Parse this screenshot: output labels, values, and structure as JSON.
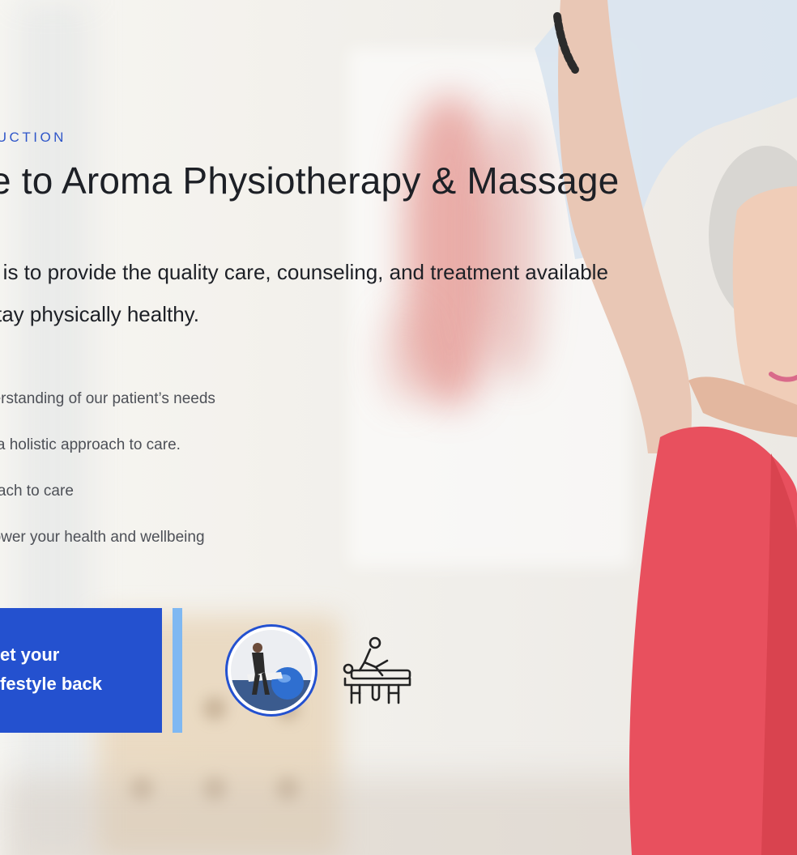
{
  "intro": {
    "eyebrow": "DUCTION",
    "heading": "e to Aroma Physiotherapy & Massage",
    "lead_line_1": "e is to provide the quality care, counseling, and treatment available",
    "lead_line_2": "stay physically healthy."
  },
  "features": [
    "derstanding of our patient’s needs",
    "g a holistic approach to care.",
    "roach to care",
    "power your health and wellbeing"
  ],
  "cta": {
    "line_1": "et your",
    "line_2": "festyle back"
  },
  "icons": {
    "thumbnail": "exercise-ball-photo",
    "massage": "massage-table-icon"
  },
  "colors": {
    "accent": "#2451cf",
    "accent_light": "#7fb8f2",
    "heading": "#1d2026",
    "body": "#4d5057"
  }
}
